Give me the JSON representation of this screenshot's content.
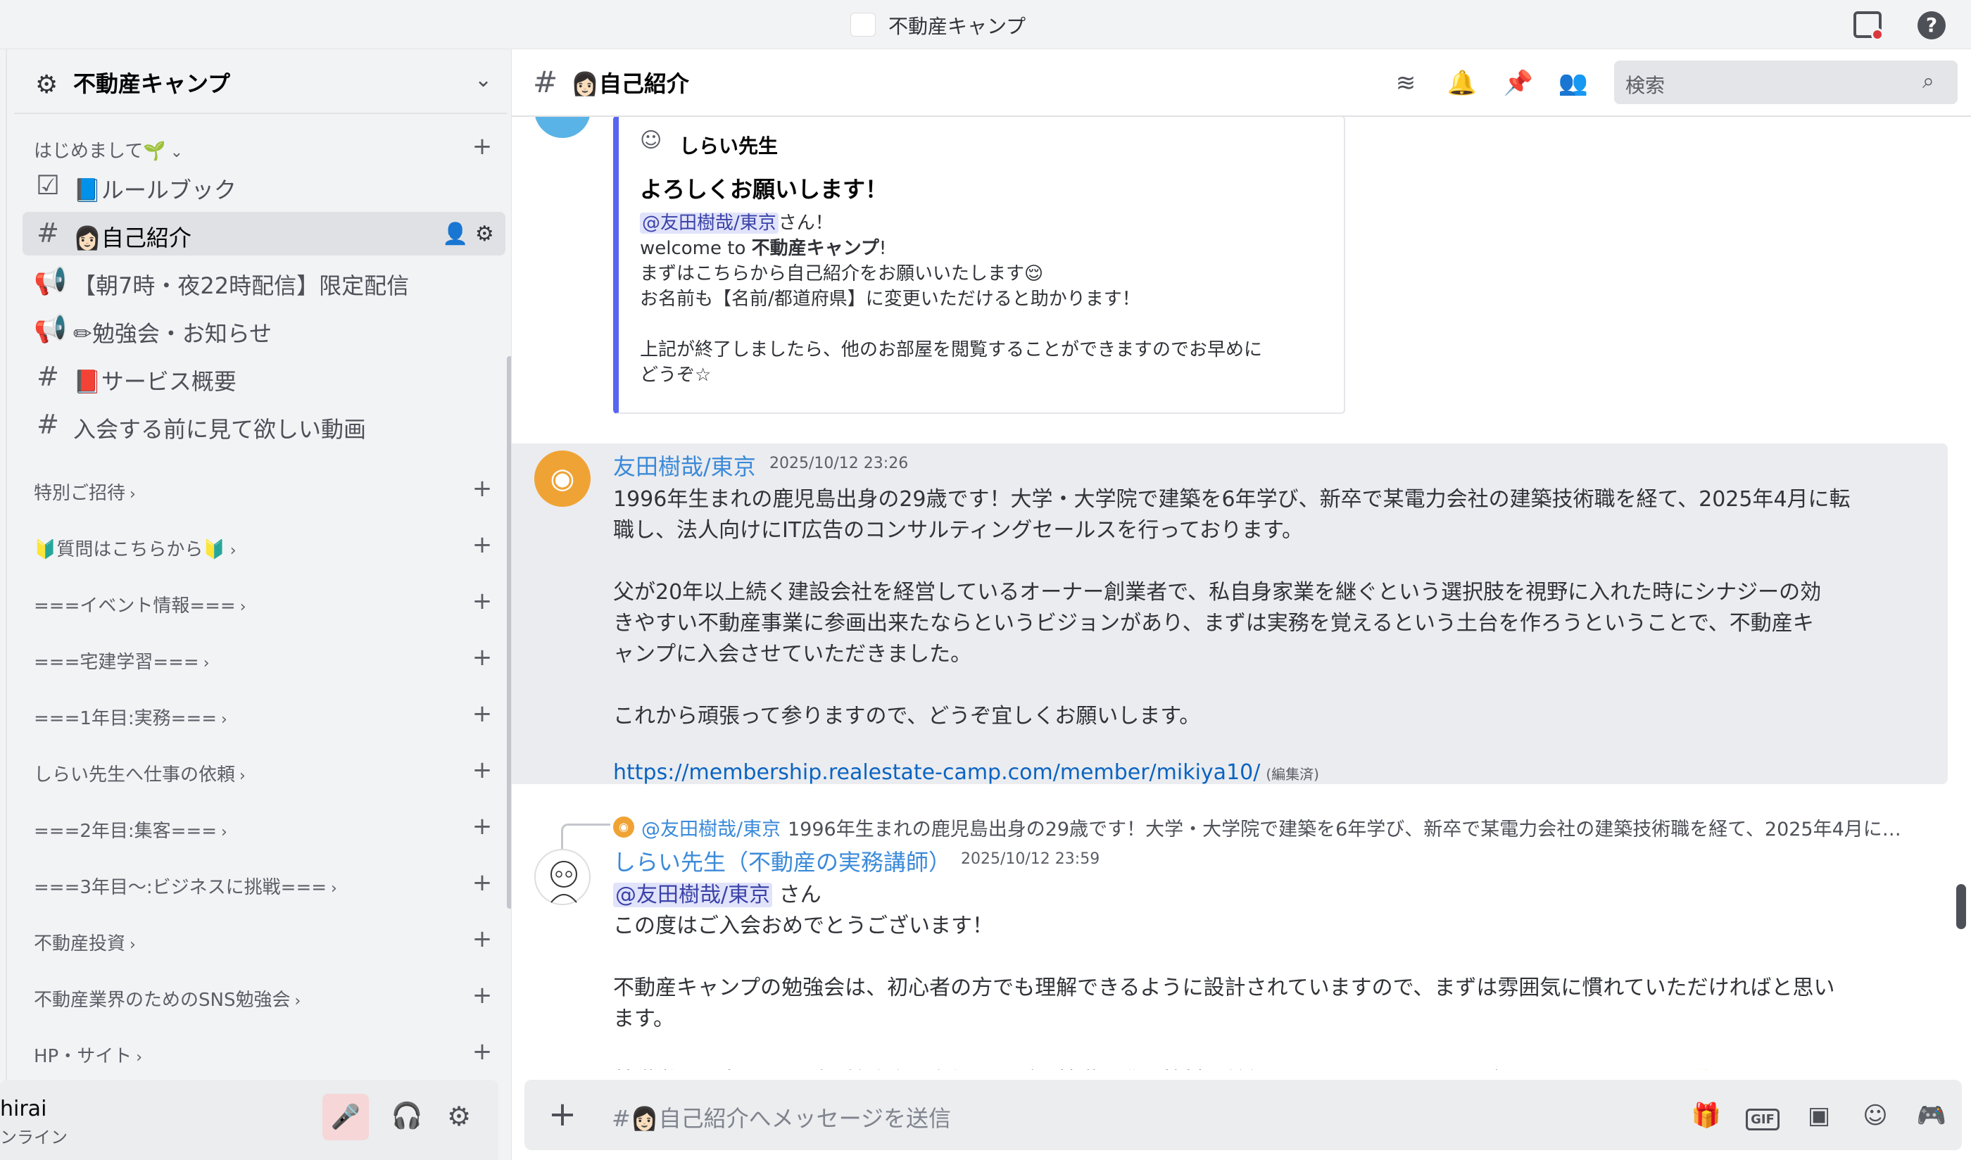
{
  "window": {
    "title": "不動産キャンプ"
  },
  "sidebar": {
    "server_name": "不動産キャンプ",
    "first_category": "はじめまして🌱",
    "channels": [
      {
        "icon": "☑",
        "label": "📘ルールブック"
      },
      {
        "icon": "#",
        "label": "👩🏻自己紹介"
      },
      {
        "icon": "📢",
        "label": "【朝7時・夜22時配信】限定配信"
      },
      {
        "icon": "📢",
        "label": "✏勉強会・お知らせ"
      },
      {
        "icon": "#",
        "label": "📕サービス概要"
      },
      {
        "icon": "#",
        "label": "入会する前に見て欲しい動画"
      }
    ],
    "categories": [
      "特別ご招待",
      "🔰質問はこちらから🔰",
      "===イベント情報===",
      "===宅建学習===",
      "===1年目:実務===",
      "しらい先生へ仕事の依頼",
      "===2年目:集客===",
      "===3年目〜:ビジネスに挑戦===",
      "不動産投資",
      "不動産業界のためのSNS勉強会",
      "HP・サイト"
    ]
  },
  "user_panel": {
    "name": "hirai",
    "status": "ンライン"
  },
  "header": {
    "channel_name": "👩🏻自己紹介",
    "search_placeholder": "検索"
  },
  "embed": {
    "author": "しらい先生",
    "title": "よろしくお願いします！",
    "mention": "@友田樹哉/東京",
    "line1_suffix": "さん！",
    "line2_prefix": "welcome to ",
    "line2_bold": "不動産キャンプ",
    "line2_suffix": "!",
    "line3": "まずはこちらから自己紹介をお願いいたします😌",
    "line4": "お名前も【名前/都道府県】に変更いただけると助かります！",
    "line5": "上記が終了しましたら、他のお部屋を閲覧することができますのでお早めに",
    "line6": "どうぞ☆"
  },
  "message1": {
    "author": "友田樹哉/東京",
    "timestamp": "2025/10/12 23:26",
    "lines": [
      "1996年生まれの鹿児島出身の29歳です！大学・大学院で建築を6年学び、新卒で某電力会社の建築技術職を経て、2025年4月に転",
      "職し、法人向けにIT広告のコンサルティングセールスを行っております。",
      "父が20年以上続く建設会社を経営しているオーナー創業者で、私自身家業を継ぐという選択肢を視野に入れた時にシナジーの効",
      "きやすい不動産事業に参画出来たならというビジョンがあり、まずは実務を覚えるという土台を作ろうということで、不動産キ",
      "ャンプに入会させていただきました。",
      "これから頑張って参りますので、どうぞ宜しくお願いします。"
    ],
    "link": "https://membership.realestate-camp.com/member/mikiya10/",
    "edited": "(編集済)"
  },
  "reply": {
    "author": "@友田樹哉/東京",
    "text": "1996年生まれの鹿児島出身の29歳です！大学・大学院で建築を6年学び、新卒で某電力会社の建築技術職を経て、2025年4月に…"
  },
  "message2": {
    "author": "しらい先生（不動産の実務講師）",
    "timestamp": "2025/10/12 23:59",
    "mention": "@友田樹哉/東京",
    "mention_suffix": "さん",
    "lines": [
      "この度はご入会おめでとうございます！",
      "不動産キャンプの勉強会は、初心者の方でも理解できるように設計されていますので、まずは雰囲気に慣れていただければと思い",
      "ます。",
      "基礎学習も大切ですが、勉強会に参加しながら基礎の動画教材を並行して進めていただくのが一番のおすすめです✨"
    ]
  },
  "composer": {
    "placeholder": "#👩🏻自己紹介へメッセージを送信",
    "gif_label": "GIF"
  }
}
